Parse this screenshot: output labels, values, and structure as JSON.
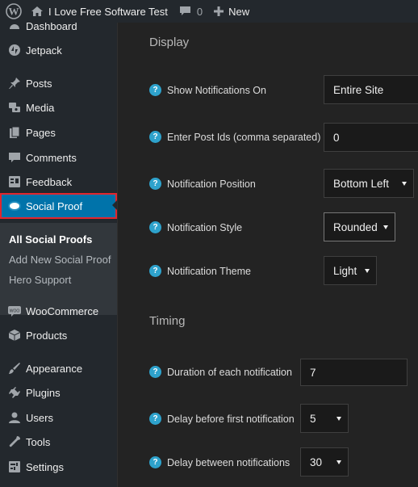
{
  "adminbar": {
    "site_name": "I Love Free Software Test",
    "comments_count": "0",
    "new_label": "New"
  },
  "sidebar": {
    "items": [
      {
        "label": "Dashboard",
        "icon": "dashboard-icon"
      },
      {
        "label": "Jetpack",
        "icon": "jetpack-icon"
      },
      {
        "label": "Posts",
        "icon": "pin-icon"
      },
      {
        "label": "Media",
        "icon": "media-icon"
      },
      {
        "label": "Pages",
        "icon": "pages-icon"
      },
      {
        "label": "Comments",
        "icon": "comment-icon"
      },
      {
        "label": "Feedback",
        "icon": "feedback-icon"
      },
      {
        "label": "Social Proof",
        "icon": "speech-bubble-icon"
      },
      {
        "label": "WooCommerce",
        "icon": "woocommerce-icon"
      },
      {
        "label": "Products",
        "icon": "products-icon"
      },
      {
        "label": "Appearance",
        "icon": "brush-icon"
      },
      {
        "label": "Plugins",
        "icon": "plugin-icon"
      },
      {
        "label": "Users",
        "icon": "users-icon"
      },
      {
        "label": "Tools",
        "icon": "wrench-icon"
      },
      {
        "label": "Settings",
        "icon": "settings-icon"
      }
    ],
    "submenu": [
      "All Social Proofs",
      "Add New Social Proof",
      "Hero Support"
    ]
  },
  "display": {
    "title": "Display",
    "show_on": {
      "label": "Show Notifications On",
      "value": "Entire Site"
    },
    "post_ids": {
      "label": "Enter Post Ids (comma separated)",
      "value": "0"
    },
    "position": {
      "label": "Notification Position",
      "value": "Bottom Left"
    },
    "style": {
      "label": "Notification Style",
      "value": "Rounded"
    },
    "theme": {
      "label": "Notification Theme",
      "value": "Light"
    }
  },
  "timing": {
    "title": "Timing",
    "duration": {
      "label": "Duration of each notification",
      "value": "7"
    },
    "delay_first": {
      "label": "Delay before first notification",
      "value": "5"
    },
    "delay_between": {
      "label": "Delay between notifications",
      "value": "30"
    }
  },
  "colors": {
    "accent": "#0073aa",
    "highlight_border": "#e2262e",
    "help": "#2ea2cc"
  }
}
